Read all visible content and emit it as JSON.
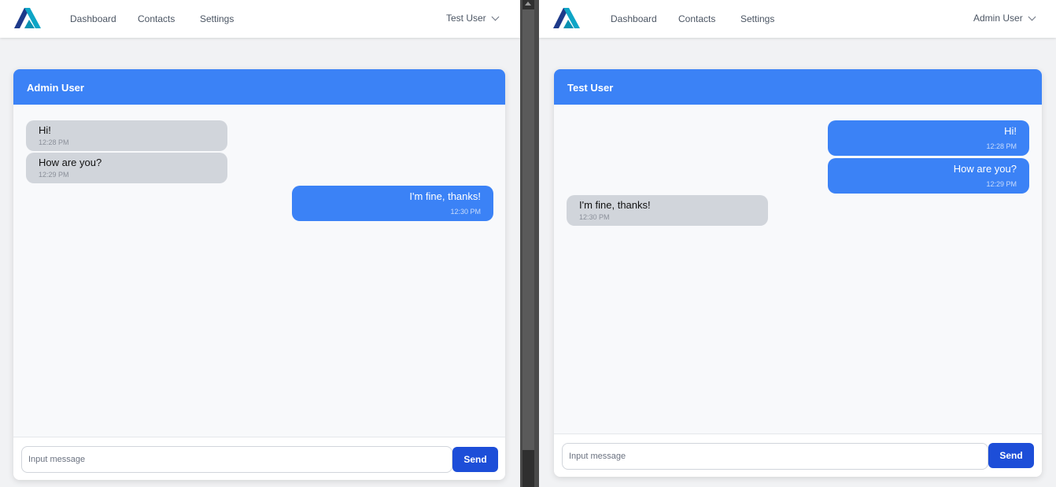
{
  "left": {
    "nav": {
      "dashboard": "Dashboard",
      "contacts": "Contacts",
      "settings": "Settings",
      "user": "Test User"
    },
    "chat": {
      "title": "Admin User",
      "messages": [
        {
          "text": "Hi!",
          "time": "12:28 PM",
          "direction": "received"
        },
        {
          "text": "How are you?",
          "time": "12:29 PM",
          "direction": "received"
        },
        {
          "text": "I'm fine, thanks!",
          "time": "12:30 PM",
          "direction": "sent"
        }
      ],
      "input_placeholder": "Input message",
      "send_label": "Send"
    }
  },
  "right": {
    "nav": {
      "dashboard": "Dashboard",
      "contacts": "Contacts",
      "settings": "Settings",
      "user": "Admin User"
    },
    "chat": {
      "title": "Test User",
      "messages": [
        {
          "text": "Hi!",
          "time": "12:28 PM",
          "direction": "sent"
        },
        {
          "text": "How are you?",
          "time": "12:29 PM",
          "direction": "sent"
        },
        {
          "text": "I'm fine, thanks!",
          "time": "12:30 PM",
          "direction": "received"
        }
      ],
      "input_placeholder": "Input message",
      "send_label": "Send"
    }
  },
  "colors": {
    "accent": "#3b82f6",
    "send_button": "#1d4ed8",
    "received_bubble": "#d1d5db",
    "header_bg": "#ffffff",
    "page_bg": "#f1f2f4"
  },
  "icons": {
    "logo": "brand-logo-icon",
    "dropdown": "chevron-down-icon"
  }
}
